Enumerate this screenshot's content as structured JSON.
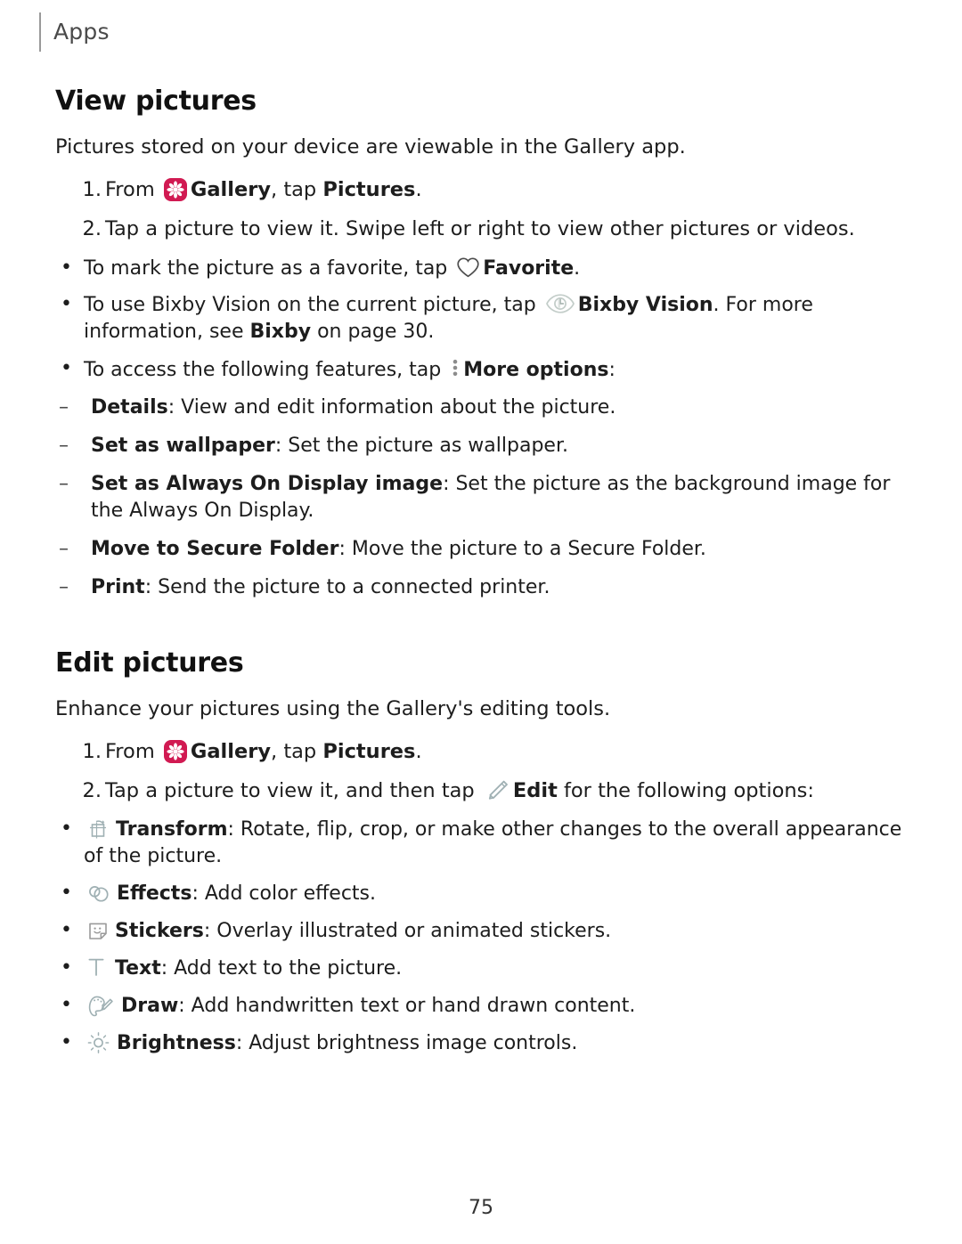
{
  "header": {
    "label": "Apps"
  },
  "sections": [
    {
      "title": "View pictures",
      "intro": "Pictures stored on your device are viewable in the Gallery app.",
      "steps": [
        {
          "num": "1.",
          "before_icon": "From ",
          "icon": "gallery-icon",
          "app_name": "Gallery",
          "mid": ", tap ",
          "target": "Pictures",
          "after": "."
        },
        {
          "num": "2.",
          "text": "Tap a picture to view it. Swipe left or right to view other pictures or videos."
        }
      ],
      "bullets": [
        {
          "before_icon": "To mark the picture as a favorite, tap ",
          "icon": "heart-icon",
          "label": "Favorite",
          "after": "."
        },
        {
          "before_icon": "To use Bixby Vision on the current picture, tap ",
          "icon": "bixby-vision-icon",
          "label": "Bixby Vision",
          "after": ". For more information, see ",
          "ref": "Bixby",
          "after2": " on page 30."
        },
        {
          "before_icon": "To access the following features, tap ",
          "icon": "more-options-icon",
          "label": "More options",
          "after": ":"
        }
      ],
      "dashes": [
        {
          "term": "Details",
          "desc": ": View and edit information about the picture."
        },
        {
          "term": "Set as wallpaper",
          "desc": ": Set the picture as wallpaper."
        },
        {
          "term": "Set as Always On Display image",
          "desc": ": Set the picture as the background image for the Always On Display."
        },
        {
          "term": "Move to Secure Folder",
          "desc": ": Move the picture to a Secure Folder."
        },
        {
          "term": "Print",
          "desc": ": Send the picture to a connected printer."
        }
      ]
    },
    {
      "title": "Edit pictures",
      "intro": "Enhance your pictures using the Gallery's editing tools.",
      "steps": [
        {
          "num": "1.",
          "before_icon": "From ",
          "icon": "gallery-icon",
          "app_name": "Gallery",
          "mid": ", tap ",
          "target": "Pictures",
          "after": "."
        },
        {
          "num": "2.",
          "before_icon": "Tap a picture to view it, and then tap ",
          "icon": "edit-pencil-icon",
          "label": "Edit",
          "after": " for the following options:"
        }
      ],
      "tool_bullets": [
        {
          "icon": "transform-icon",
          "term": "Transform",
          "desc": ": Rotate, flip, crop, or make other changes to the overall appearance of the picture."
        },
        {
          "icon": "effects-icon",
          "term": "Effects",
          "desc": ": Add color effects."
        },
        {
          "icon": "stickers-icon",
          "term": "Stickers",
          "desc": ": Overlay illustrated or animated stickers."
        },
        {
          "icon": "text-icon",
          "term": "Text",
          "desc": ": Add text to the picture."
        },
        {
          "icon": "draw-icon",
          "term": "Draw",
          "desc": ": Add handwritten text or hand drawn content."
        },
        {
          "icon": "brightness-icon",
          "term": "Brightness",
          "desc": ": Adjust brightness image controls."
        }
      ]
    }
  ],
  "footer": {
    "page_number": "75"
  },
  "colors": {
    "gallery_icon_bg": "#D11A52",
    "icon_gray": "#8fa0a3",
    "dots_gray": "#8c8c8c",
    "text": "#1d1d1d"
  }
}
